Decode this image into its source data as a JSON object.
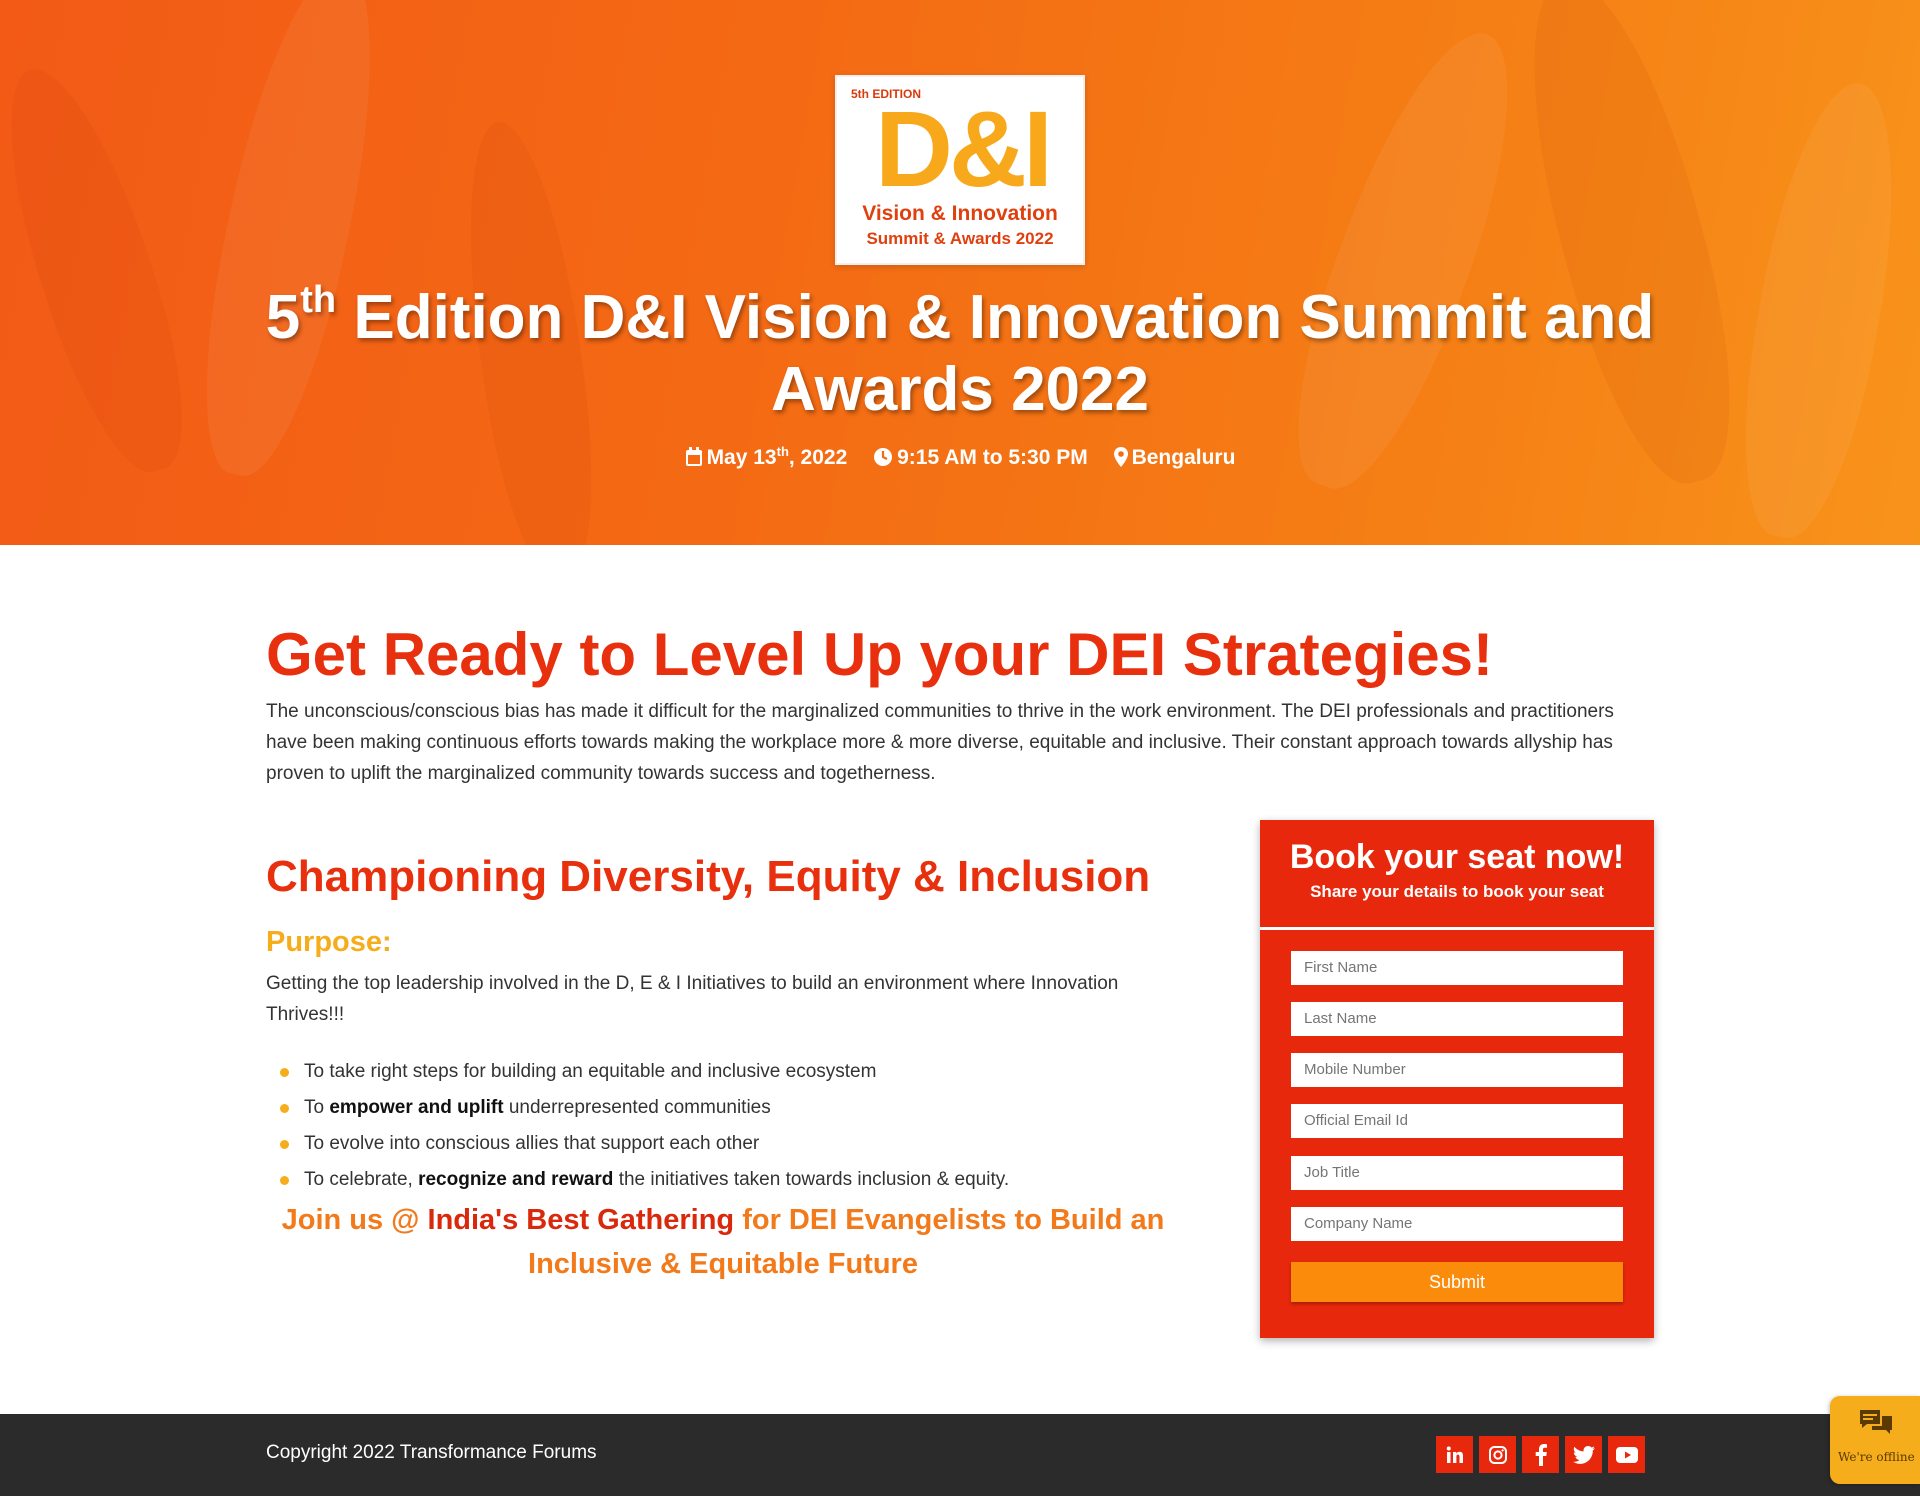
{
  "hero": {
    "logo": {
      "edition": "5th EDITION",
      "mark": "D&I",
      "line1": "Vision & Innovation",
      "line2": "Summit & Awards 2022"
    },
    "title_num": "5",
    "title_sup": "th",
    "title_rest": " Edition D&I Vision & Innovation Summit and Awards 2022",
    "date_main": "May 13",
    "date_sup": "th",
    "date_year": ", 2022",
    "time": "9:15 AM to 5:30 PM",
    "location": "Bengaluru",
    "icons": [
      "calendar-icon",
      "clock-icon",
      "map-pin-icon"
    ]
  },
  "main": {
    "heading": "Get Ready to Level Up your DEI Strategies!",
    "intro": "The unconscious/conscious bias has made it difficult for the marginalized communities to thrive in the work environment. The DEI professionals and practitioners have been making continuous efforts towards making the workplace more & more diverse, equitable and inclusive. Their constant approach towards allyship has proven to uplift the marginalized community towards success and togetherness.",
    "subheading": "Championing Diversity, Equity & Inclusion",
    "purpose_label": "Purpose:",
    "purpose_text": "Getting the top leadership involved in the D, E & I Initiatives to build an environment where Innovation Thrives!!!",
    "bullets": [
      {
        "pre": "To take right steps for building an equitable and inclusive ecosystem",
        "bold": "",
        "post": ""
      },
      {
        "pre": "To ",
        "bold": "empower and uplift",
        "post": " underrepresented communities"
      },
      {
        "pre": "To evolve into conscious allies that support each other",
        "bold": "",
        "post": ""
      },
      {
        "pre": "To celebrate, ",
        "bold": "recognize and reward",
        "post": " the initiatives taken towards inclusion & equity."
      }
    ],
    "join_pre": "Join us @ ",
    "join_bold": "India's Best Gathering",
    "join_post": " for DEI Evangelists to Build an Inclusive & Equitable Future"
  },
  "form": {
    "title": "Book your seat now!",
    "subtitle": "Share your details to book your seat",
    "fields": [
      {
        "placeholder": "First Name",
        "value": ""
      },
      {
        "placeholder": "Last Name",
        "value": ""
      },
      {
        "placeholder": "Mobile Number",
        "value": ""
      },
      {
        "placeholder": "Official Email Id",
        "value": ""
      },
      {
        "placeholder": "Job Title",
        "value": ""
      },
      {
        "placeholder": "Company Name",
        "value": ""
      }
    ],
    "submit_label": "Submit"
  },
  "footer": {
    "copyright": "Copyright 2022 Transformance Forums",
    "socials": [
      "linkedin-icon",
      "instagram-icon",
      "facebook-icon",
      "twitter-icon",
      "youtube-icon"
    ]
  },
  "chat": {
    "status": "We're offline"
  },
  "colors": {
    "brand_red": "#e8280c",
    "brand_orange": "#f46a14",
    "accent_yellow": "#f6ad1b",
    "submit_orange": "#fb8b0a",
    "footer_bg": "#2b2b2b"
  }
}
